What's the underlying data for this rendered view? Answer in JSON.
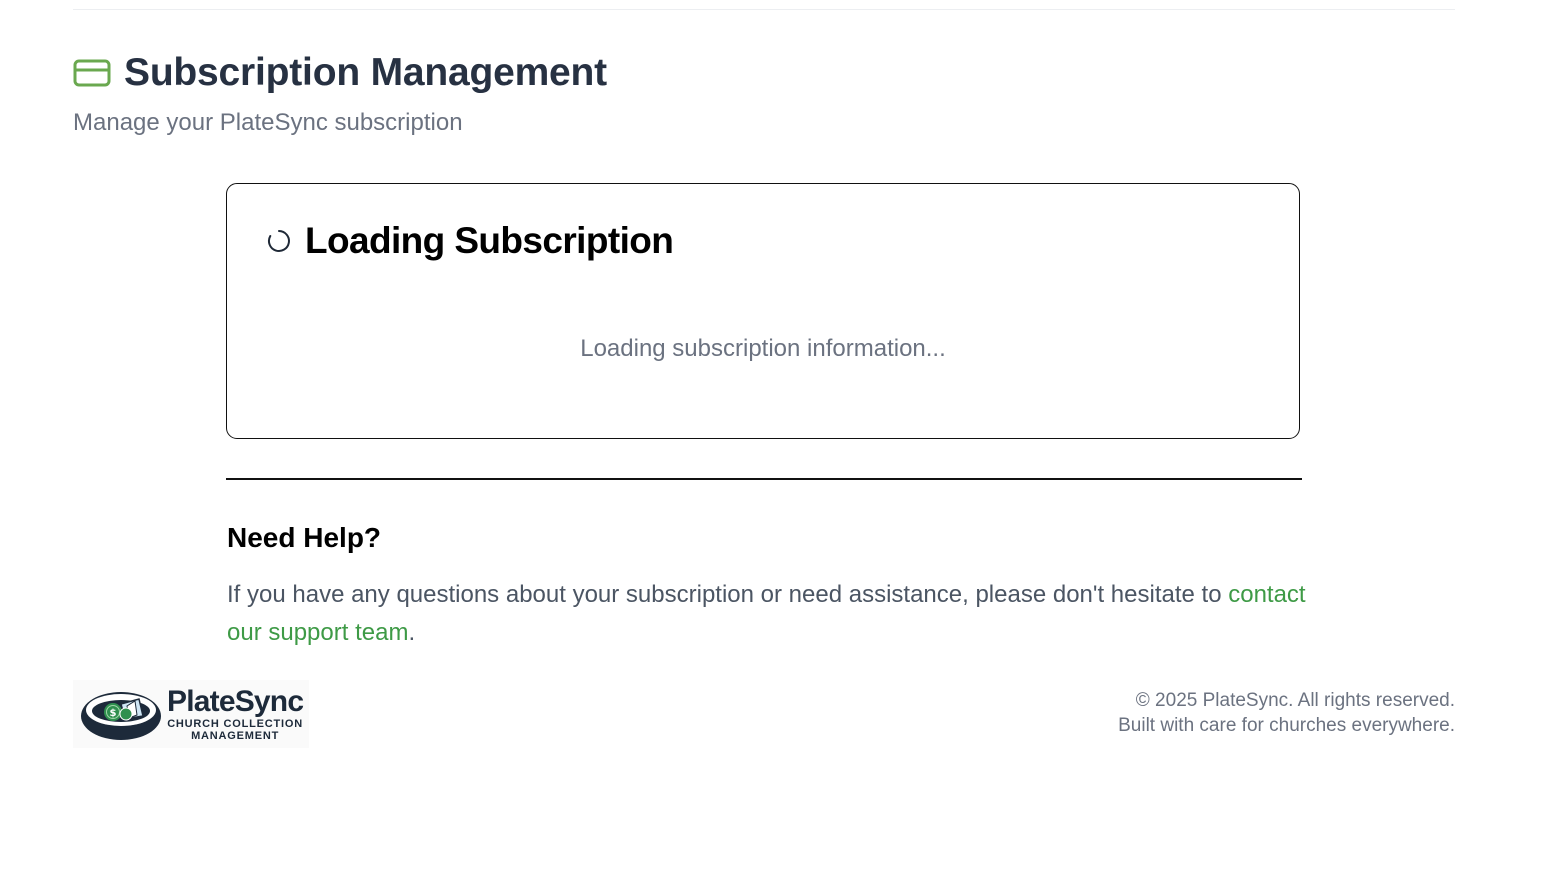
{
  "header": {
    "title": "Subscription Management",
    "subtitle": "Manage your PlateSync subscription",
    "icon": "credit-card-icon",
    "icon_color": "#6aa84f"
  },
  "loading_card": {
    "icon": "spinner-icon",
    "title": "Loading Subscription",
    "message": "Loading subscription information..."
  },
  "help": {
    "title": "Need Help?",
    "text": "If you have any questions about your subscription or need assistance, please don't hesitate to",
    "link_label": "contact our support team",
    "trailing": ".",
    "link_color": "#3e9a46"
  },
  "footer": {
    "logo": {
      "name": "PlateSync",
      "tagline_line1": "CHURCH COLLECTION",
      "tagline_line2": "MANAGEMENT"
    },
    "copyright": "© 2025 PlateSync. All rights reserved.",
    "note": "Built with care for churches everywhere."
  }
}
